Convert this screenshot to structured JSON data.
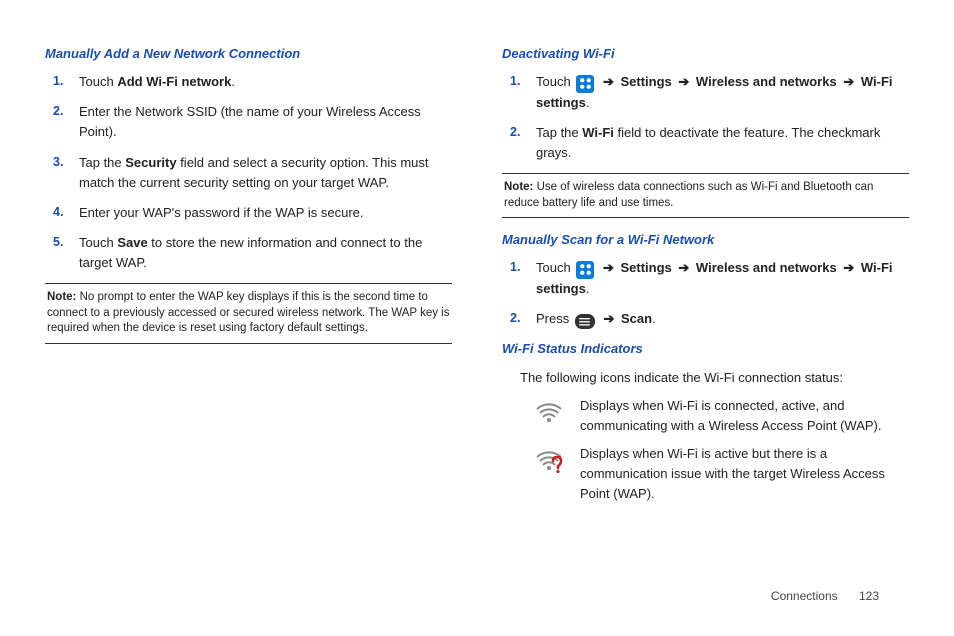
{
  "left": {
    "heading1": "Manually Add a New Network Connection",
    "steps1": [
      {
        "n": "1.",
        "pre": "Touch ",
        "b1": "Add Wi-Fi network",
        "post": "."
      },
      {
        "n": "2.",
        "text": "Enter the Network SSID (the name of your Wireless Access Point)."
      },
      {
        "n": "3.",
        "pre": "Tap the ",
        "b1": "Security",
        "post": " field and select a security option. This must match the current security setting on your target WAP."
      },
      {
        "n": "4.",
        "text": "Enter your WAP's password if the WAP is secure."
      },
      {
        "n": "5.",
        "pre": "Touch ",
        "b1": "Save",
        "post": " to store the new information and connect to the target WAP."
      }
    ],
    "note1_label": "Note:",
    "note1_body": " No prompt to enter the WAP key displays if this is the second time to connect to a previously accessed or secured wireless network. The WAP key is required when the device is reset using factory default settings."
  },
  "right": {
    "heading1": "Deactivating Wi-Fi",
    "deact1_pre": "Touch ",
    "deact1_b_settings": "Settings",
    "deact1_b_wn": "Wireless and networks",
    "deact1_b_ws": "Wi-Fi settings",
    "deact1_num": "1.",
    "deact2_num": "2.",
    "deact2_pre": "Tap the ",
    "deact2_b": "Wi-Fi",
    "deact2_post": " field to deactivate the feature. The checkmark grays.",
    "note2_label": "Note:",
    "note2_body": " Use of wireless data connections such as Wi-Fi and Bluetooth can reduce battery life and use times.",
    "heading2": "Manually Scan for a Wi-Fi Network",
    "scan1_num": "1.",
    "scan1_pre": "Touch ",
    "scan1_b_settings": "Settings",
    "scan1_b_wn": "Wireless and networks",
    "scan1_b_ws": "Wi-Fi settings",
    "scan2_num": "2.",
    "scan2_pre": "Press ",
    "scan2_b": "Scan",
    "heading3": "Wi-Fi Status Indicators",
    "status_intro": "The following icons indicate the Wi-Fi connection status:",
    "status1": "Displays when Wi-Fi is connected, active, and communicating with a Wireless Access Point (WAP).",
    "status2": "Displays when Wi-Fi is active but there is a communication issue with the target Wireless Access Point (WAP)."
  },
  "arrow": "➔",
  "period": ".",
  "footer": {
    "section": "Connections",
    "page": "123"
  }
}
